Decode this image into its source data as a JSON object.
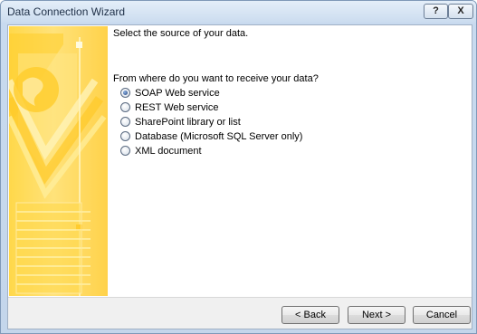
{
  "window": {
    "title": "Data Connection Wizard",
    "help_label": "?",
    "close_label": "X"
  },
  "page": {
    "heading": "Select the source of your data.",
    "question": "From where do you want to receive your data?"
  },
  "options": [
    {
      "label": "SOAP Web service",
      "selected": true
    },
    {
      "label": "REST Web service",
      "selected": false
    },
    {
      "label": "SharePoint library or list",
      "selected": false
    },
    {
      "label": "Database (Microsoft SQL Server only)",
      "selected": false
    },
    {
      "label": "XML document",
      "selected": false
    }
  ],
  "buttons": {
    "back": "< Back",
    "next": "Next >",
    "cancel": "Cancel"
  },
  "colors": {
    "banner_accent": "#ffd84a",
    "title_bar": "#d9e6f4"
  }
}
